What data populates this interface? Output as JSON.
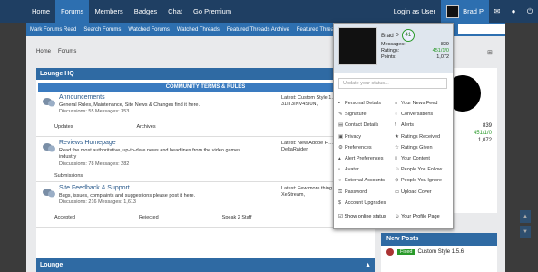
{
  "nav": {
    "items": [
      "Home",
      "Forums",
      "Members",
      "Badges",
      "Chat",
      "Go Premium"
    ],
    "active": "Forums"
  },
  "user": {
    "login_as": "Login as User",
    "name": "Brad P"
  },
  "subnav": [
    "Mark Forums Read",
    "Search Forums",
    "Watched Forums",
    "Watched Threads",
    "Featured Threads Archive",
    "Featured Threads"
  ],
  "breadcrumb": [
    "Home",
    "Forums"
  ],
  "category": {
    "title": "Lounge HQ",
    "subheader": "COMMUNITY TERMS & RULES"
  },
  "forums": [
    {
      "title": "Announcements",
      "desc": "General Rules, Maintenance, Site News & Changes find it here.",
      "stats": "Discussions: 55   Messages: 353",
      "latest": "Latest: Custom Style 1.5...",
      "latest2": "31IT3INV4SI0N,",
      "subs": [
        "Updates",
        "Archives"
      ]
    },
    {
      "title": "Reviews Homepage",
      "desc": "Read the most authoritative, up-to-date news and headlines from the video games industry",
      "stats": "Discussions: 78   Messages: 282",
      "latest": "Latest: New Adobe Fl...",
      "latest2": "DeltaRaider,",
      "subs": [
        "Submissions"
      ]
    },
    {
      "title": "Site Feedback & Support",
      "desc": "Bugs, issues, complaints and suggestions please post it here.",
      "stats": "Discussions: 216   Messages: 1,613",
      "latest": "Latest: Few more thing...",
      "latest2": "XeStream,",
      "subs": [
        "Accepted",
        "Rejected",
        "Speak 2 Staff"
      ]
    }
  ],
  "category2": {
    "title": "Lounge"
  },
  "sidebar": {
    "stats": [
      "839",
      "451/1/0",
      "1,072"
    ]
  },
  "new_posts": {
    "title": "New Posts",
    "badge": "Fixed",
    "text": "Custom Style 1.5.6"
  },
  "popup": {
    "name": "Brad P",
    "level": "41",
    "stats": [
      {
        "k": "Messages:",
        "v": "839"
      },
      {
        "k": "Ratings:",
        "v": "451/1/0"
      },
      {
        "k": "Points:",
        "v": "1,072"
      }
    ],
    "status_placeholder": "Update your status...",
    "left": [
      "Personal Details",
      "Signature",
      "Contact Details",
      "Privacy",
      "Preferences",
      "Alert Preferences",
      "Avatar",
      "External Accounts",
      "Password",
      "Account Upgrades"
    ],
    "right": [
      "Your News Feed",
      "Conversations",
      "Alerts",
      "Ratings Received",
      "Ratings Given",
      "Your Content",
      "People You Follow",
      "People You Ignore",
      "Upload Cover"
    ],
    "show_online": "Show online status",
    "profile": "Your Profile Page"
  }
}
